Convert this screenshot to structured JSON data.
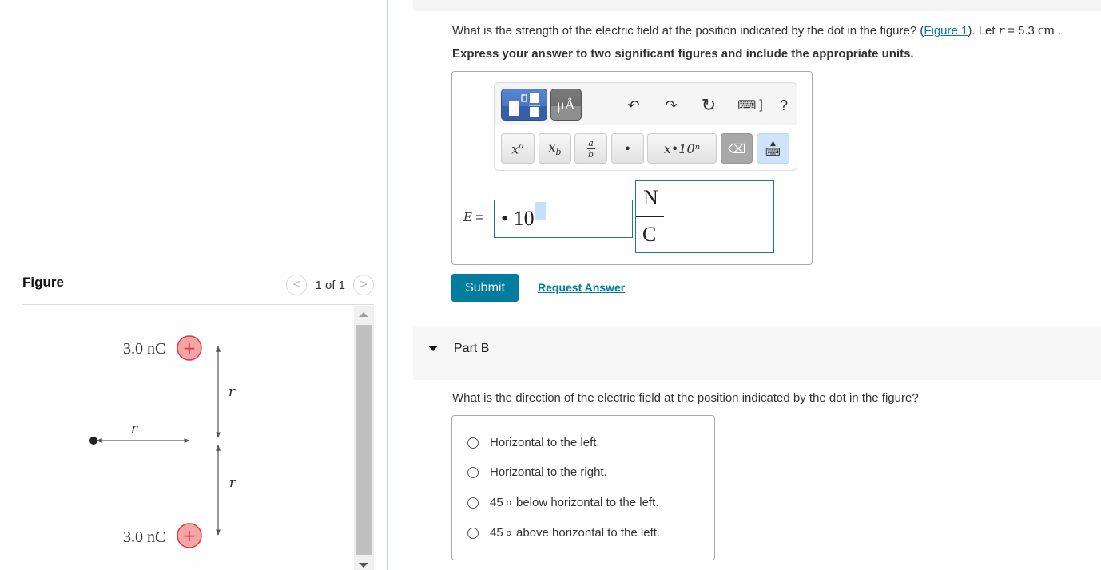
{
  "partA": {
    "question_prefix": "What is the strength of the electric field at the position indicated by the dot in the figure? (",
    "figure_link": "Figure 1",
    "question_mid": "). Let ",
    "var_r": "r",
    "question_eq": " = 5.3 ",
    "unit_cm": "cm",
    "question_end": " .",
    "instruction": "Express your answer to two significant figures and include the appropriate units.",
    "toolbar": {
      "templates_icon": "templates-icon",
      "units_label": "μÅ",
      "undo_icon": "↶",
      "redo_icon": "↷",
      "reset_icon": "↻",
      "keyboard_shortcut_icon": "⌨",
      "keyboard_bracket": "]",
      "help_label": "?",
      "superscript_label": "xᵃ",
      "subscript_label": "x_b",
      "fraction_num": "a",
      "fraction_den": "b",
      "dot_label": "•",
      "sci_notation_label": "x•10ⁿ",
      "delete_icon": "⌫",
      "keyboard_icon": "⌨"
    },
    "answer": {
      "variable": "E",
      "equals": " =",
      "value_text": "• 10",
      "unit_numerator": "N",
      "unit_denominator": "C"
    },
    "submit_label": "Submit",
    "request_answer_label": "Request Answer"
  },
  "partB": {
    "title": "Part B",
    "question": "What is the direction of the electric field at the position indicated by the dot in the figure?",
    "options": [
      {
        "prefix": "",
        "deg": "",
        "text": "Horizontal to the left."
      },
      {
        "prefix": "",
        "deg": "",
        "text": "Horizontal to the right."
      },
      {
        "prefix": "45",
        "deg": "o",
        "text": "below horizontal to the left."
      },
      {
        "prefix": "45",
        "deg": "o",
        "text": "above horizontal to the left."
      }
    ]
  },
  "figure": {
    "title": "Figure",
    "page_indicator": "1 of 1",
    "prev_icon": "<",
    "next_icon": ">",
    "charge_top_label": "3.0 nC",
    "charge_bottom_label": "3.0 nC",
    "charge_sign": "+",
    "distance_label": "r"
  },
  "colors": {
    "accent": "#007c9e",
    "charge_fill": "#f4a5a5",
    "charge_stroke": "#e0383e"
  }
}
